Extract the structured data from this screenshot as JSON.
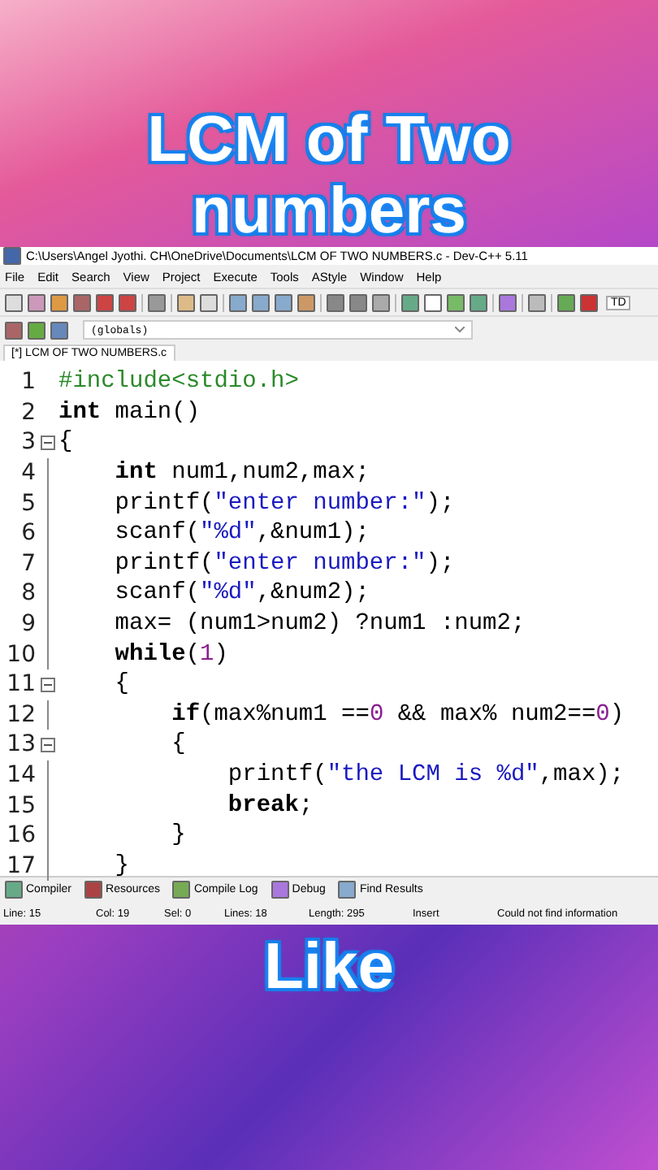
{
  "headline": [
    "LCM of Two",
    "numbers"
  ],
  "window": {
    "title": "C:\\Users\\Angel Jyothi. CH\\OneDrive\\Documents\\LCM OF TWO NUMBERS.c - Dev-C++ 5.11"
  },
  "menu": [
    "File",
    "Edit",
    "Search",
    "View",
    "Project",
    "Execute",
    "Tools",
    "AStyle",
    "Window",
    "Help"
  ],
  "toolbar_field": "TD",
  "scope_dropdown": "(globals)",
  "tabs": [
    {
      "label": "[*] LCM OF TWO NUMBERS.c",
      "selected": true
    }
  ],
  "code_lines": [
    {
      "number": "1",
      "fold": false,
      "tokens": [
        {
          "kind": "pre",
          "text": "#include<stdio.h>"
        }
      ]
    },
    {
      "number": "2",
      "fold": false,
      "tokens": [
        {
          "kind": "kw",
          "text": "int"
        },
        {
          "kind": "plain",
          "text": " main()"
        }
      ]
    },
    {
      "number": "3",
      "fold": true,
      "tokens": [
        {
          "kind": "plain",
          "text": "{"
        }
      ]
    },
    {
      "number": "4",
      "fold": false,
      "tokens": [
        {
          "kind": "kw",
          "text": "    int"
        },
        {
          "kind": "plain",
          "text": " num1,num2,max;"
        }
      ]
    },
    {
      "number": "5",
      "fold": false,
      "tokens": [
        {
          "kind": "plain",
          "text": "    printf("
        },
        {
          "kind": "str",
          "text": "\"enter number:\""
        },
        {
          "kind": "plain",
          "text": ");"
        }
      ]
    },
    {
      "number": "6",
      "fold": false,
      "tokens": [
        {
          "kind": "plain",
          "text": "    scanf("
        },
        {
          "kind": "str",
          "text": "\"%d\""
        },
        {
          "kind": "plain",
          "text": ",&num1);"
        }
      ]
    },
    {
      "number": "7",
      "fold": false,
      "tokens": [
        {
          "kind": "plain",
          "text": "    printf("
        },
        {
          "kind": "str",
          "text": "\"enter number:\""
        },
        {
          "kind": "plain",
          "text": ");"
        }
      ]
    },
    {
      "number": "8",
      "fold": false,
      "tokens": [
        {
          "kind": "plain",
          "text": "    scanf("
        },
        {
          "kind": "str",
          "text": "\"%d\""
        },
        {
          "kind": "plain",
          "text": ",&num2);"
        }
      ]
    },
    {
      "number": "9",
      "fold": false,
      "tokens": [
        {
          "kind": "plain",
          "text": "    max= (num1>num2) ?num1 :num2;"
        }
      ]
    },
    {
      "number": "10",
      "fold": false,
      "tokens": [
        {
          "kind": "kw",
          "text": "    while"
        },
        {
          "kind": "plain",
          "text": "("
        },
        {
          "kind": "num",
          "text": "1"
        },
        {
          "kind": "plain",
          "text": ")"
        }
      ]
    },
    {
      "number": "11",
      "fold": true,
      "tokens": [
        {
          "kind": "plain",
          "text": "    {"
        }
      ]
    },
    {
      "number": "12",
      "fold": false,
      "tokens": [
        {
          "kind": "kw",
          "text": "        if"
        },
        {
          "kind": "plain",
          "text": "(max%num1 =="
        },
        {
          "kind": "num",
          "text": "0"
        },
        {
          "kind": "plain",
          "text": " && max% num2=="
        },
        {
          "kind": "num",
          "text": "0"
        },
        {
          "kind": "plain",
          "text": ")"
        }
      ]
    },
    {
      "number": "13",
      "fold": true,
      "tokens": [
        {
          "kind": "plain",
          "text": "        {"
        }
      ]
    },
    {
      "number": "14",
      "fold": false,
      "tokens": [
        {
          "kind": "plain",
          "text": "            printf("
        },
        {
          "kind": "str",
          "text": "\"the LCM is %d\""
        },
        {
          "kind": "plain",
          "text": ",max);"
        }
      ]
    },
    {
      "number": "15",
      "fold": false,
      "tokens": [
        {
          "kind": "kw",
          "text": "            break"
        },
        {
          "kind": "plain",
          "text": ";"
        }
      ]
    },
    {
      "number": "16",
      "fold": false,
      "tokens": [
        {
          "kind": "plain",
          "text": "        }"
        }
      ]
    },
    {
      "number": "17",
      "fold": false,
      "tokens": [
        {
          "kind": "plain",
          "text": "    }"
        }
      ]
    }
  ],
  "bottom_tabs": [
    "Compiler",
    "Resources",
    "Compile Log",
    "Debug",
    "Find Results"
  ],
  "status_bar": [
    "Line:  15",
    "Col:  19",
    "Sel:  0",
    "Lines:  18",
    "Length:  295",
    "Insert",
    "Could not find information"
  ],
  "footer": "Like"
}
